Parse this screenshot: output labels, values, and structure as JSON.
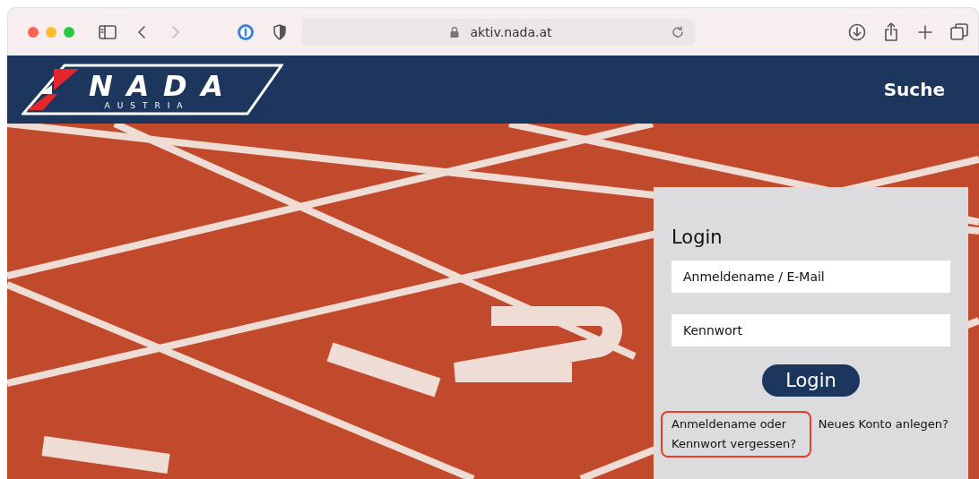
{
  "browser": {
    "address": "aktiv.nada.at"
  },
  "header": {
    "logo": {
      "title": "NADA",
      "subtitle": "AUSTRIA"
    },
    "nav": [
      "Suche"
    ]
  },
  "login": {
    "title": "Login",
    "fields": [
      {
        "placeholder": "Anmeldename / E-Mail"
      },
      {
        "placeholder": "Kennwort"
      }
    ],
    "button": "Login",
    "links": [
      {
        "label": "Anmeldename oder Kennwort vergessen?",
        "highlighted": true
      },
      {
        "label": "Neues Konto anlegen?",
        "highlighted": false
      }
    ]
  }
}
